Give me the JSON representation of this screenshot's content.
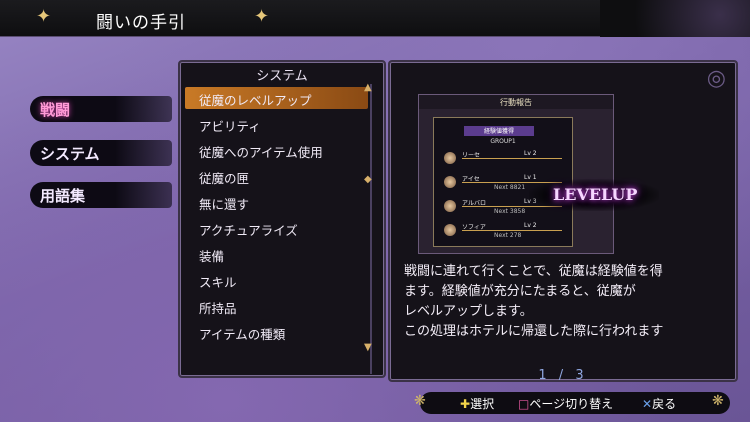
{
  "header": {
    "title": "闘いの手引"
  },
  "categories": [
    {
      "label": "戦闘",
      "active": true
    },
    {
      "label": "システム",
      "active": false
    },
    {
      "label": "用語集",
      "active": false
    }
  ],
  "list": {
    "header": "システム",
    "items": [
      "従魔のレベルアップ",
      "アビリティ",
      "従魔へのアイテム使用",
      "従魔の匣",
      "無に還す",
      "アクチュアライズ",
      "装備",
      "スキル",
      "所持品",
      "アイテムの種類"
    ],
    "selected_index": 0
  },
  "preview": {
    "bar_label": "行動報告",
    "card_head": "経験値獲得",
    "group_label": "GROUP1",
    "units": [
      {
        "name": "リーセ",
        "lv": "Lv 2",
        "next": ""
      },
      {
        "name": "アイセ",
        "lv": "Lv 1",
        "next": "Next 8821"
      },
      {
        "name": "アルバロ",
        "lv": "Lv 3",
        "next": "Next 3858"
      },
      {
        "name": "ソフィア",
        "lv": "Lv 2",
        "next": "Next 278"
      }
    ],
    "levelup_text": "LEVELUP"
  },
  "detail": {
    "lines": [
      "戦闘に連れて行くことで、従魔は経験値を得",
      "ます。経験値が充分にたまると、従魔が",
      "レベルアップします。",
      "この処理はホテルに帰還した際に行われます"
    ],
    "pager": "1 / 3"
  },
  "controls": {
    "select": "選択",
    "page_switch": "ページ切り替え",
    "back": "戻る"
  },
  "colors": {
    "accent_selected": "#c97a26",
    "category_active": "#ff9ad6"
  }
}
